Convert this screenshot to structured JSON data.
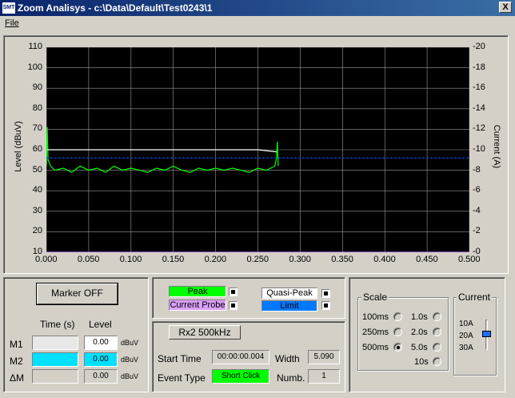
{
  "window": {
    "title": "Zoom Analisys - c:\\Data\\Default\\Test0243\\1",
    "app_icon": "app-icon",
    "close_label": "X"
  },
  "menu": {
    "file": "File"
  },
  "chart": {
    "ylabel_left": "Level (dBuV)",
    "ylabel_right": "Current (A)",
    "ticks_left": [
      "110",
      "100",
      "90",
      "80",
      "70",
      "60",
      "50",
      "40",
      "30",
      "20",
      "10"
    ],
    "ticks_right": [
      "-20",
      "-18",
      "-16",
      "-14",
      "-12",
      "-10",
      "-8",
      "-6",
      "-4",
      "-2",
      "-0"
    ],
    "ticks_x": [
      "0.000",
      "0.050",
      "0.100",
      "0.150",
      "0.200",
      "0.250",
      "0.300",
      "0.350",
      "0.400",
      "0.450",
      "0.500"
    ]
  },
  "chart_data": {
    "type": "line",
    "xlim": [
      0,
      0.5
    ],
    "ylim": [
      10,
      110
    ],
    "y2lim": [
      -20,
      0
    ],
    "grid": true,
    "series": [
      {
        "name": "Peak",
        "color": "#00ff00",
        "x": [
          0.0,
          0.001,
          0.002,
          0.005,
          0.01,
          0.02,
          0.03,
          0.04,
          0.05,
          0.06,
          0.07,
          0.08,
          0.09,
          0.1,
          0.11,
          0.12,
          0.13,
          0.14,
          0.15,
          0.16,
          0.17,
          0.18,
          0.19,
          0.2,
          0.21,
          0.22,
          0.23,
          0.24,
          0.25,
          0.26,
          0.27,
          0.272,
          0.273,
          0.274
        ],
        "y": [
          52,
          71,
          55,
          52,
          50,
          51,
          49,
          52,
          50,
          51,
          49,
          52,
          50,
          51,
          50,
          49,
          51,
          50,
          52,
          50,
          49,
          51,
          50,
          51,
          50,
          51,
          50,
          49,
          51,
          50,
          52,
          56,
          64,
          52
        ]
      },
      {
        "name": "Quasi-Peak",
        "color": "#ffffff",
        "x": [
          0.001,
          0.05,
          0.1,
          0.15,
          0.2,
          0.25,
          0.272
        ],
        "y": [
          60,
          60,
          60,
          60,
          60,
          60,
          59
        ]
      },
      {
        "name": "Limit",
        "color": "#0050ff",
        "x": [
          0.0,
          0.5
        ],
        "y": [
          56,
          56
        ]
      },
      {
        "name": "Current Probe",
        "color": "#cc66ff",
        "x": [
          0.0,
          0.5
        ],
        "y": [
          10,
          10
        ]
      }
    ]
  },
  "controls": {
    "marker_button": "Marker OFF",
    "time_header": "Time (s)",
    "level_header": "Level",
    "rows": [
      {
        "label": "M1",
        "time": "",
        "level": "0.00",
        "unit": "dBuV",
        "time_color": "#e8e8e8",
        "level_color": "#ffffff"
      },
      {
        "label": "M2",
        "time": "",
        "level": "0.00",
        "unit": "dBuV",
        "time_color": "#00e0ff",
        "level_color": "#00e0ff"
      },
      {
        "label": "ΔM",
        "time": "",
        "level": "0.00",
        "unit": "dBuV",
        "time_color": "#d4d0c8",
        "level_color": "#d4d0c8"
      }
    ]
  },
  "legend": {
    "peak": "Peak",
    "current_probe": "Current Probe",
    "quasi_peak": "Quasi-Peak",
    "limit": "Limit",
    "peak_color": "#00ff00",
    "current_probe_color": "#d9a0ff",
    "quasi_peak_color": "#ffffff",
    "limit_color": "#0078ff"
  },
  "event": {
    "receiver": "Rx2 500kHz",
    "start_time_label": "Start Time",
    "start_time": "00:00:00.004",
    "width_label": "Width",
    "width": "5.090",
    "event_type_label": "Event Type",
    "event_type": "Short Click",
    "numb_label": "Numb.",
    "numb": "1"
  },
  "scale": {
    "title": "Scale",
    "options": [
      "100ms",
      "1.0s",
      "250ms",
      "2.0s",
      "500ms",
      "5.0s",
      "10s"
    ],
    "selected": "5.0s"
  },
  "current": {
    "title": "Current",
    "options": [
      "10A",
      "20A",
      "30A"
    ],
    "selected": "20A"
  }
}
